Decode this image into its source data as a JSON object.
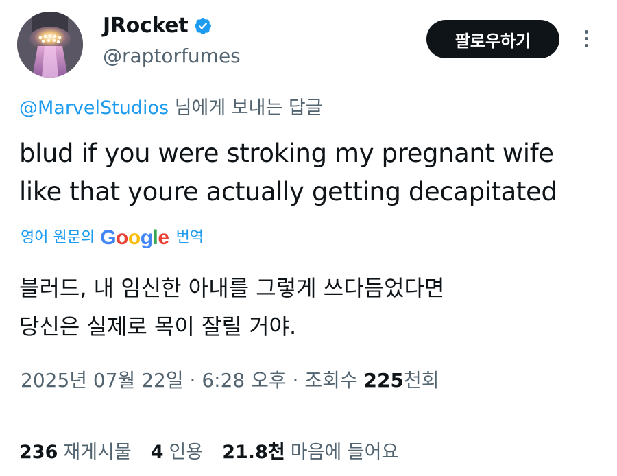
{
  "author": {
    "display_name": "JRocket",
    "handle": "@raptorfumes",
    "verified": true,
    "verified_icon": "verified-badge-icon",
    "verified_color": "#1d9bf0"
  },
  "follow_button": {
    "label": "팔로우하기"
  },
  "more_button": {
    "icon": "more-vertical-icon"
  },
  "reply_to": {
    "mention": "@MarvelStudios",
    "suffix": " 님에게 보내는 답글"
  },
  "tweet": {
    "text_line1": "blud if you were stroking my pregnant wife",
    "text_line2": "like that youre actually getting decapitated"
  },
  "translation": {
    "prefix": "영어 원문의",
    "brand": "Google",
    "suffix": "번역",
    "text_line1": "블러드, 내 임신한 아내를 그렇게 쓰다듬었다면",
    "text_line2": "당신은 실제로 목이 잘릴 거야."
  },
  "meta": {
    "date": "2025년 07월 22일",
    "separator": "·",
    "time": "6:28 오후",
    "views_label": "조회수",
    "views_count": "225",
    "views_unit": "천회"
  },
  "stats": {
    "retweets_count": "236",
    "retweets_label": "재게시물",
    "quotes_count": "4",
    "quotes_label": "인용",
    "likes_count": "21.8",
    "likes_unit": "천",
    "likes_label": "마음에 들어요"
  },
  "colors": {
    "text_primary": "#0f1419",
    "text_secondary": "#536471",
    "accent": "#1d9bf0"
  }
}
